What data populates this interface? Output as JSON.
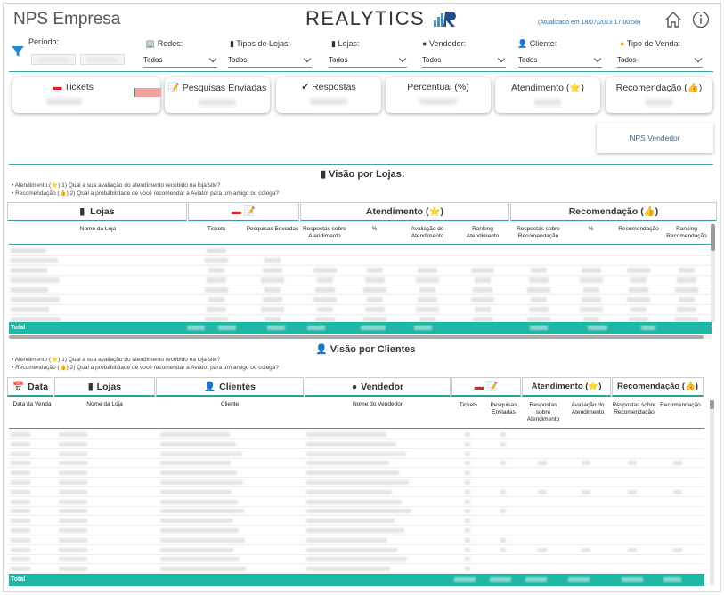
{
  "header": {
    "title": "NPS Empresa",
    "logo_text": "REALYTICS",
    "updated": "(Atualizado em 18/07/2023 17:00:58)"
  },
  "filters": {
    "periodo_label": "Período:",
    "redes": {
      "label": "Redes:",
      "value": "Todos"
    },
    "tipos_lojas": {
      "label": "Tipos de Lojas:",
      "value": "Todos"
    },
    "lojas": {
      "label": "Lojas:",
      "value": "Todos"
    },
    "vendedor": {
      "label": "Vendedor:",
      "value": "Todos"
    },
    "cliente": {
      "label": "Cliente:",
      "value": "Todos"
    },
    "tipo_venda": {
      "label": "Tipo de Venda:",
      "value": "Todos"
    }
  },
  "kpis": {
    "tickets": "Tickets",
    "pesquisas": "Pesquisas Enviadas",
    "respostas": "Respostas",
    "percentual": "Percentual (%)",
    "atendimento": "Atendimento (⭐)",
    "recomendacao": "Recomendação (👍)"
  },
  "nps_vendedor": "NPS Vendedor",
  "lojas_section": {
    "title": "Visão por Lojas:",
    "legend1": "• Atendimento (⭐)     1) Qual a sua avaliação do atendimento recebido na loja/site?",
    "legend2": "• Recomendação (👍)   2) Qual a probabilidade de você recomendar a Aviator para um amigo ou colega?",
    "group_headers": {
      "lojas": "Lojas",
      "atendimento": "Atendimento (⭐)",
      "recomendacao": "Recomendação (👍)"
    },
    "columns": [
      "Nome da Loja",
      "Tickets",
      "Pesquisas Enviadas",
      "Respostas sobre Atendimento",
      "%",
      "Avaliação do Atendimento",
      "Ranking Atendimento",
      "Respostas sobre Recomendação",
      "%",
      "Recomendação",
      "Ranking Recomendação"
    ],
    "total": "Total"
  },
  "clientes_section": {
    "title": "Visão por Clientes",
    "legend1": "• Atendimento (⭐)     1) Qual a sua avaliação do atendimento recebido na loja/site?",
    "legend2": "• Recomendação (👍)   2) Qual a probabilidade de você recomendar a Aviator para um amigo ou colega?",
    "group_headers": {
      "data": "Data",
      "lojas": "Lojas",
      "clientes": "Clientes",
      "vendedor": "Vendedor",
      "atendimento": "Atendimento (⭐)",
      "recomendacao": "Recomendação (👍)"
    },
    "columns": [
      "Data da Venda",
      "Nome da Loja",
      "Cliente",
      "Nome do Vendedor",
      "Tickets",
      "Pesquisas Enviadas",
      "Respostas sobre Atendimento",
      "Avaliação do Atendimento",
      "Respostas sobre Recomendação",
      "Recomendação"
    ],
    "total": "Total"
  },
  "colors": {
    "teal": "#1eb6a5",
    "accent": "#2aa39c",
    "link": "#2b6ca3"
  }
}
